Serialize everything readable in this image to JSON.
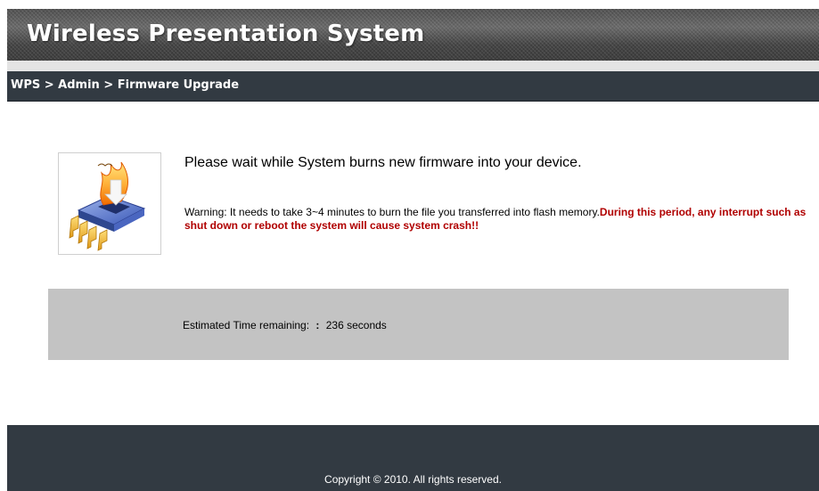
{
  "header": {
    "title": "Wireless Presentation System"
  },
  "breadcrumb": "WPS > Admin > Firmware Upgrade",
  "main": {
    "icon": "firmware-chip-icon",
    "heading": "Please wait while System burns new firmware into your device.",
    "warning_text": "Warning: It needs to take 3~4 minutes to burn the file you transferred into flash memory.",
    "warning_danger": "During this period, any interrupt such as shut down or reboot the system will cause system crash!!",
    "estimated_label": "Estimated Time remaining:",
    "estimated_separator": ":",
    "estimated_value": "236 seconds"
  },
  "footer": {
    "copyright": "Copyright © 2010. All rights reserved."
  },
  "colors": {
    "nav_bar": "#323a42",
    "danger_text": "#b00000",
    "status_panel": "#c3c3c3"
  }
}
